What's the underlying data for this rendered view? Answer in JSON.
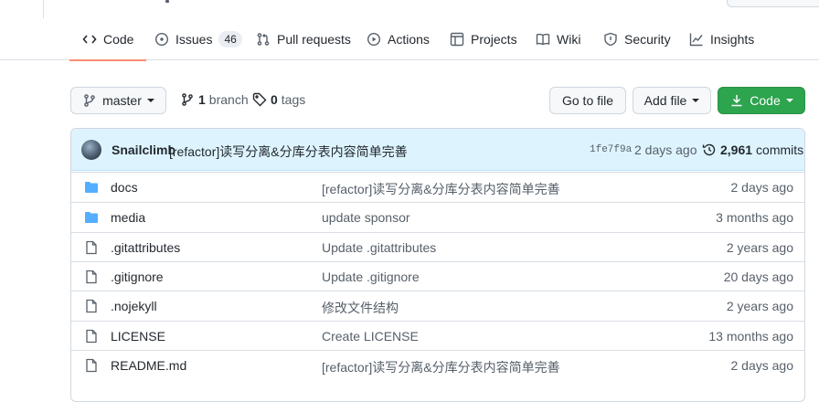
{
  "tabs": [
    {
      "label": "Code",
      "icon": "code-icon"
    },
    {
      "label": "Issues",
      "icon": "issue-opened-icon",
      "count": "46"
    },
    {
      "label": "Pull requests",
      "icon": "git-pull-request-icon"
    },
    {
      "label": "Actions",
      "icon": "play-icon"
    },
    {
      "label": "Projects",
      "icon": "table-icon"
    },
    {
      "label": "Wiki",
      "icon": "book-icon"
    },
    {
      "label": "Security",
      "icon": "shield-icon"
    },
    {
      "label": "Insights",
      "icon": "graph-icon"
    }
  ],
  "toolbar": {
    "branch_label": "master",
    "branch_count": "1",
    "branch_word": "branch",
    "tag_count": "0",
    "tag_word": "tags",
    "go_to_file": "Go to file",
    "add_file": "Add file",
    "code": "Code"
  },
  "latest_commit": {
    "author": "Snailclimb",
    "message": "[refactor]读写分离&分库分表内容简单完善",
    "sha": "1fe7f9a",
    "date": "2 days ago",
    "commits_count": "2,961",
    "commits_word": "commits"
  },
  "files": [
    {
      "type": "folder",
      "name": "docs",
      "message": "[refactor]读写分离&分库分表内容简单完善",
      "age": "2 days ago"
    },
    {
      "type": "folder",
      "name": "media",
      "message": "update sponsor",
      "age": "3 months ago"
    },
    {
      "type": "file",
      "name": ".gitattributes",
      "message": "Update .gitattributes",
      "age": "2 years ago"
    },
    {
      "type": "file",
      "name": ".gitignore",
      "message": "Update .gitignore",
      "age": "20 days ago"
    },
    {
      "type": "file",
      "name": ".nojekyll",
      "message": "修改文件结构",
      "age": "2 years ago"
    },
    {
      "type": "file",
      "name": "LICENSE",
      "message": "Create LICENSE",
      "age": "13 months ago"
    },
    {
      "type": "file",
      "name": "README.md",
      "message": "[refactor]读写分离&分库分表内容简单完善",
      "age": "2 days ago"
    }
  ],
  "colors": {
    "accent_underline": "#fd8c73",
    "green_button": "#2da44e",
    "folder": "#54aeff",
    "header_bg": "#ddf4ff"
  }
}
